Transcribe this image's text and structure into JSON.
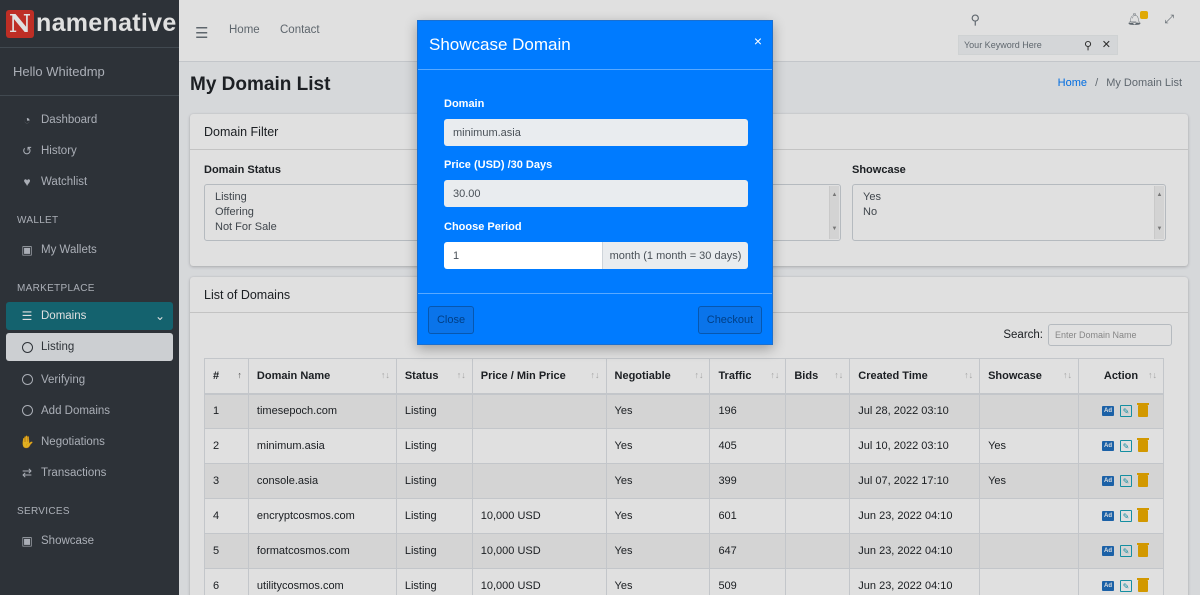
{
  "brand": {
    "logo_letter": "N",
    "name": "namenative"
  },
  "user": {
    "greeting": "Hello Whitedmp"
  },
  "sidebar": {
    "items_main": [
      {
        "label": "Dashboard",
        "icon": "dashboard-icon"
      },
      {
        "label": "History",
        "icon": "history-icon"
      },
      {
        "label": "Watchlist",
        "icon": "heart-icon"
      }
    ],
    "wallet_header": "WALLET",
    "wallet_item": "My Wallets",
    "marketplace_header": "MARKETPLACE",
    "domains_item": "Domains",
    "sub_items": [
      "Listing",
      "Verifying",
      "Add Domains"
    ],
    "negotiations": "Negotiations",
    "transactions": "Transactions",
    "services_header": "SERVICES",
    "showcase": "Showcase"
  },
  "topbar": {
    "links": [
      "Home",
      "Contact"
    ],
    "search_placeholder": "Your Keyword Here"
  },
  "page": {
    "title": "My Domain List",
    "breadcrumb_home": "Home",
    "breadcrumb_sep": "/",
    "breadcrumb_current": "My Domain List"
  },
  "filter": {
    "title": "Domain Filter",
    "status_label": "Domain Status",
    "status_options": [
      "Listing",
      "Offering",
      "Not For Sale"
    ],
    "showcase_label": "Showcase",
    "showcase_options": [
      "Yes",
      "No"
    ]
  },
  "list": {
    "title": "List of Domains",
    "search_label": "Search:",
    "search_placeholder": "Enter Domain Name",
    "columns": [
      "#",
      "Domain Name",
      "Status",
      "Price / Min Price",
      "Negotiable",
      "Traffic",
      "Bids",
      "Created Time",
      "Showcase",
      "Action"
    ],
    "rows": [
      {
        "n": "1",
        "domain": "timesepoch.com",
        "status": "Listing",
        "price": "",
        "negotiable": "Yes",
        "traffic": "196",
        "bids": "",
        "created": "Jul 28, 2022 03:10",
        "showcase": ""
      },
      {
        "n": "2",
        "domain": "minimum.asia",
        "status": "Listing",
        "price": "",
        "negotiable": "Yes",
        "traffic": "405",
        "bids": "",
        "created": "Jul 10, 2022 03:10",
        "showcase": "Yes"
      },
      {
        "n": "3",
        "domain": "console.asia",
        "status": "Listing",
        "price": "",
        "negotiable": "Yes",
        "traffic": "399",
        "bids": "",
        "created": "Jul 07, 2022 17:10",
        "showcase": "Yes"
      },
      {
        "n": "4",
        "domain": "encryptcosmos.com",
        "status": "Listing",
        "price": "10,000 USD",
        "negotiable": "Yes",
        "traffic": "601",
        "bids": "",
        "created": "Jun 23, 2022 04:10",
        "showcase": ""
      },
      {
        "n": "5",
        "domain": "formatcosmos.com",
        "status": "Listing",
        "price": "10,000 USD",
        "negotiable": "Yes",
        "traffic": "647",
        "bids": "",
        "created": "Jun 23, 2022 04:10",
        "showcase": ""
      },
      {
        "n": "6",
        "domain": "utilitycosmos.com",
        "status": "Listing",
        "price": "10,000 USD",
        "negotiable": "Yes",
        "traffic": "509",
        "bids": "",
        "created": "Jun 23, 2022 04:10",
        "showcase": ""
      }
    ]
  },
  "modal": {
    "title": "Showcase Domain",
    "close_symbol": "×",
    "domain_label": "Domain",
    "domain_value": "minimum.asia",
    "price_label": "Price (USD) /30 Days",
    "price_value": "30.00",
    "period_label": "Choose Period",
    "period_value": "1",
    "period_addon": "month (1 month = 30 days)",
    "close_button": "Close",
    "checkout_button": "Checkout"
  },
  "colors": {
    "modal_bg": "#007bff",
    "sidebar_bg": "#343a40",
    "active_nav": "#17707e",
    "accent": "#ffc107"
  }
}
